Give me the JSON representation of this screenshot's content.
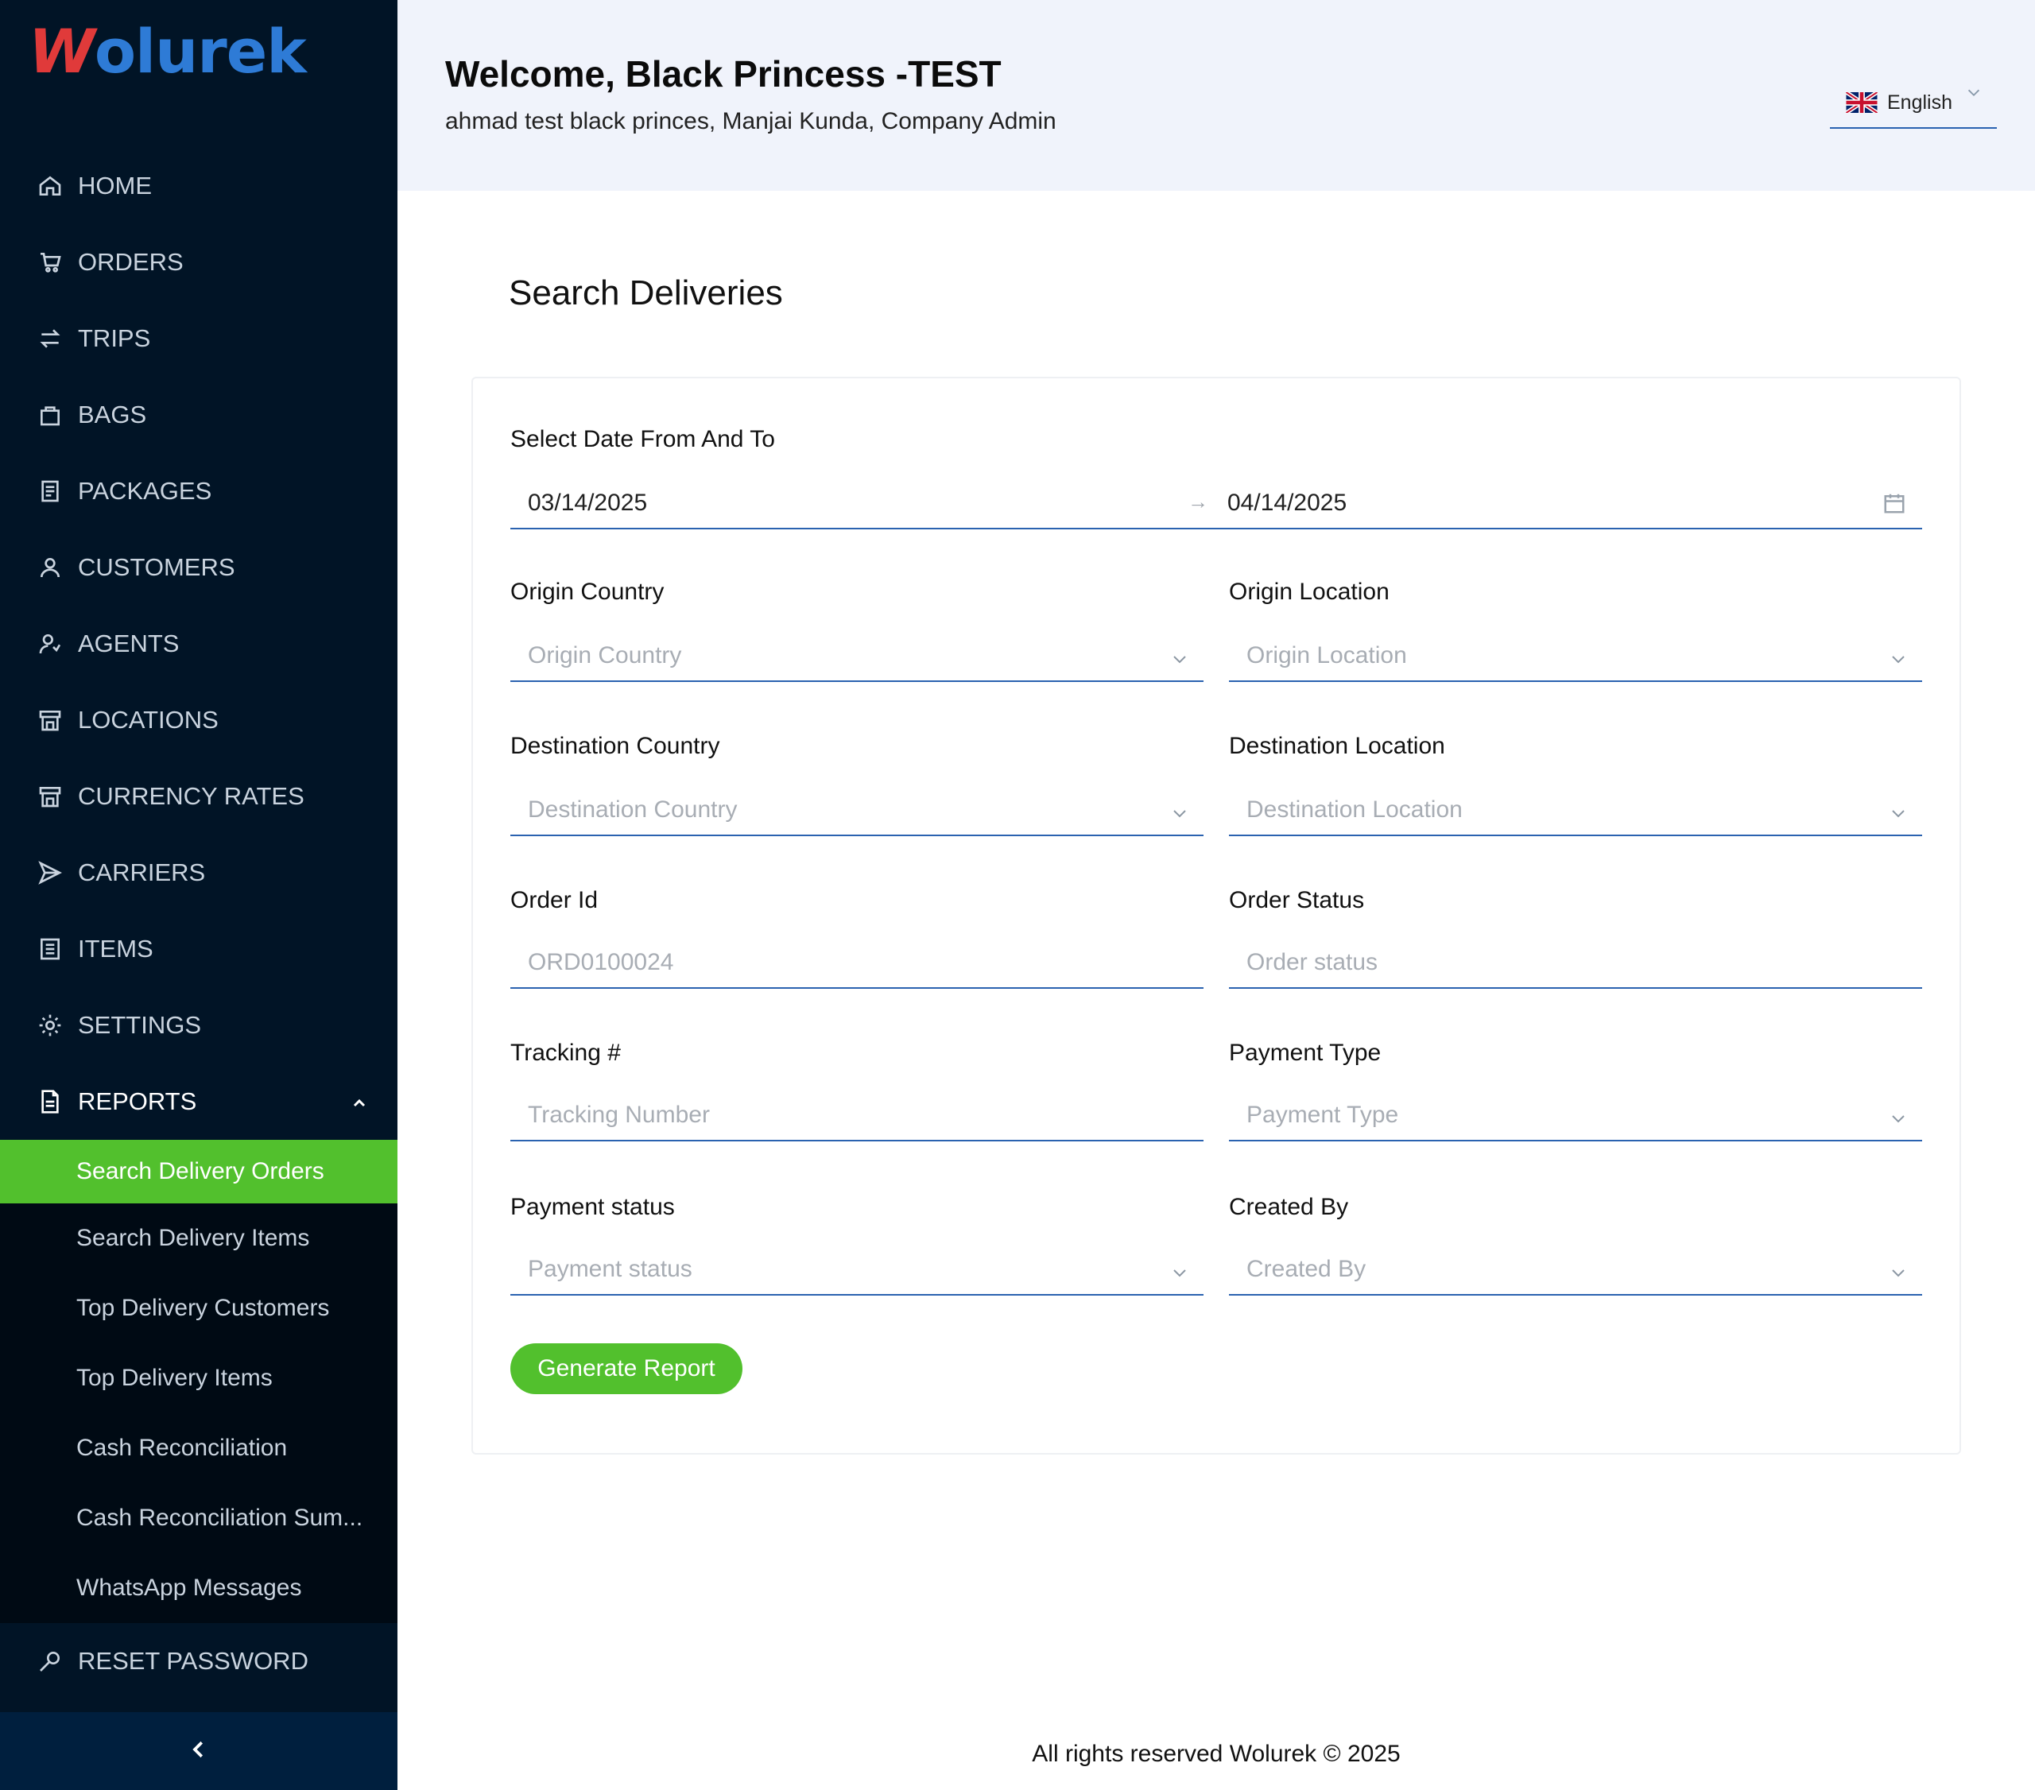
{
  "app": {
    "logo_text": "olurek",
    "logo_w": "W"
  },
  "sidebar": {
    "items": [
      {
        "label": "HOME",
        "icon": "home-icon"
      },
      {
        "label": "ORDERS",
        "icon": "cart-icon"
      },
      {
        "label": "TRIPS",
        "icon": "arrows-icon"
      },
      {
        "label": "BAGS",
        "icon": "bag-icon"
      },
      {
        "label": "PACKAGES",
        "icon": "package-icon"
      },
      {
        "label": "CUSTOMERS",
        "icon": "user-icon"
      },
      {
        "label": "AGENTS",
        "icon": "agent-icon"
      },
      {
        "label": "LOCATIONS",
        "icon": "store-icon"
      },
      {
        "label": "CURRENCY RATES",
        "icon": "store-icon"
      },
      {
        "label": "CARRIERS",
        "icon": "send-icon"
      },
      {
        "label": "ITEMS",
        "icon": "list-icon"
      },
      {
        "label": "SETTINGS",
        "icon": "gear-icon"
      },
      {
        "label": "REPORTS",
        "icon": "document-icon"
      }
    ],
    "reports_submenu": [
      {
        "label": "Search Delivery Orders",
        "active": true
      },
      {
        "label": "Search Delivery Items"
      },
      {
        "label": "Top Delivery Customers"
      },
      {
        "label": "Top Delivery Items"
      },
      {
        "label": "Cash Reconciliation"
      },
      {
        "label": "Cash Reconciliation Sum..."
      },
      {
        "label": "WhatsApp Messages"
      }
    ],
    "reset_password": "RESET PASSWORD"
  },
  "header": {
    "welcome": "Welcome, Black Princess -TEST",
    "user_line": "ahmad test black princes,  Manjai Kunda,  Company Admin",
    "language": "English"
  },
  "main": {
    "title": "Search Deliveries",
    "date_label": "Select Date From And To",
    "date_from": "03/14/2025",
    "date_to": "04/14/2025",
    "origin_country": {
      "label": "Origin Country",
      "placeholder": "Origin Country"
    },
    "origin_location": {
      "label": "Origin Location",
      "placeholder": "Origin Location"
    },
    "destination_country": {
      "label": "Destination Country",
      "placeholder": "Destination Country"
    },
    "destination_location": {
      "label": "Destination Location",
      "placeholder": "Destination Location"
    },
    "order_id": {
      "label": "Order Id",
      "placeholder": "ORD0100024"
    },
    "order_status": {
      "label": "Order Status",
      "placeholder": "Order status"
    },
    "tracking": {
      "label": "Tracking #",
      "placeholder": "Tracking Number"
    },
    "payment_type": {
      "label": "Payment Type",
      "placeholder": "Payment Type"
    },
    "payment_status": {
      "label": "Payment status",
      "placeholder": "Payment status"
    },
    "created_by": {
      "label": "Created By",
      "placeholder": "Created By"
    },
    "generate_button": "Generate Report"
  },
  "footer": {
    "text": "All rights reserved Wolurek © 2025"
  },
  "colors": {
    "sidebar_bg": "#011426",
    "accent_green": "#52c02d",
    "field_border": "#2a62b0",
    "header_bg": "#f0f3fb"
  }
}
